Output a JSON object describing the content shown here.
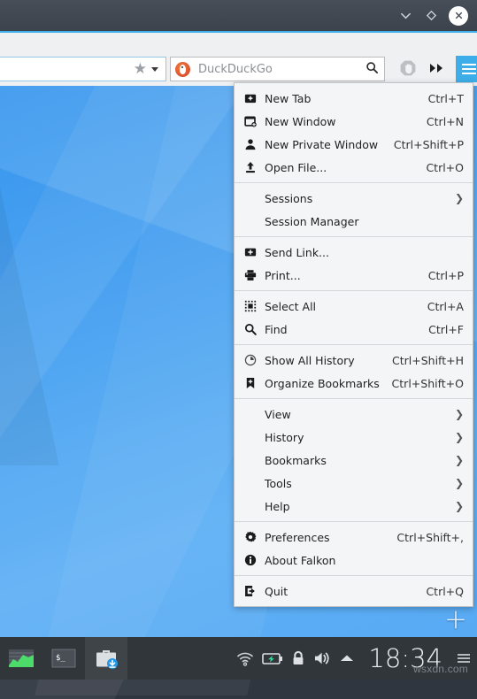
{
  "window": {
    "titlebar_buttons": [
      {
        "name": "minimize",
        "glyph": "⌄"
      },
      {
        "name": "maximize",
        "glyph": "◇"
      },
      {
        "name": "close",
        "glyph": "✕"
      }
    ]
  },
  "toolbar": {
    "url_value": "",
    "url_placeholder": "",
    "star_icon": "bookmark-star-icon",
    "search": {
      "engine_icon": "duckduckgo-icon",
      "placeholder": "DuckDuckGo",
      "value": "DuckDuckGo",
      "search_icon": "magnifier-icon"
    },
    "adblock_label": "adblock-icon",
    "forward_label": "fast-forward-icon",
    "menu_label": "hamburger-menu-icon"
  },
  "menu": {
    "groups": [
      {
        "items": [
          {
            "icon": "new-tab-icon",
            "label": "New Tab",
            "shortcut": "Ctrl+T",
            "submenu": false
          },
          {
            "icon": "new-window-icon",
            "label": "New Window",
            "shortcut": "Ctrl+N",
            "submenu": false
          },
          {
            "icon": "private-window-icon",
            "label": "New Private Window",
            "shortcut": "Ctrl+Shift+P",
            "submenu": false
          },
          {
            "icon": "open-file-icon",
            "label": "Open File...",
            "shortcut": "Ctrl+O",
            "submenu": false
          }
        ]
      },
      {
        "items": [
          {
            "icon": "",
            "label": "Sessions",
            "shortcut": "",
            "submenu": true
          },
          {
            "icon": "",
            "label": "Session Manager",
            "shortcut": "",
            "submenu": false
          }
        ]
      },
      {
        "items": [
          {
            "icon": "send-link-icon",
            "label": "Send Link...",
            "shortcut": "",
            "submenu": false
          },
          {
            "icon": "print-icon",
            "label": "Print...",
            "shortcut": "Ctrl+P",
            "submenu": false
          }
        ]
      },
      {
        "items": [
          {
            "icon": "select-all-icon",
            "label": "Select All",
            "shortcut": "Ctrl+A",
            "submenu": false
          },
          {
            "icon": "find-icon",
            "label": "Find",
            "shortcut": "Ctrl+F",
            "submenu": false
          }
        ]
      },
      {
        "items": [
          {
            "icon": "history-clock-icon",
            "label": "Show All History",
            "shortcut": "Ctrl+Shift+H",
            "submenu": false
          },
          {
            "icon": "bookmark-flag-icon",
            "label": "Organize Bookmarks",
            "shortcut": "Ctrl+Shift+O",
            "submenu": false
          }
        ]
      },
      {
        "items": [
          {
            "icon": "",
            "label": "View",
            "shortcut": "",
            "submenu": true
          },
          {
            "icon": "",
            "label": "History",
            "shortcut": "",
            "submenu": true
          },
          {
            "icon": "",
            "label": "Bookmarks",
            "shortcut": "",
            "submenu": true
          },
          {
            "icon": "",
            "label": "Tools",
            "shortcut": "",
            "submenu": true
          },
          {
            "icon": "",
            "label": "Help",
            "shortcut": "",
            "submenu": true
          }
        ]
      },
      {
        "items": [
          {
            "icon": "gear-icon",
            "label": "Preferences",
            "shortcut": "Ctrl+Shift+,",
            "submenu": false
          },
          {
            "icon": "info-icon",
            "label": "About Falkon",
            "shortcut": "",
            "submenu": false
          }
        ]
      },
      {
        "items": [
          {
            "icon": "quit-icon",
            "label": "Quit",
            "shortcut": "Ctrl+Q",
            "submenu": false
          }
        ]
      }
    ]
  },
  "desktop": {
    "add_widget_label": "+"
  },
  "taskbar": {
    "launchers": [
      {
        "name": "system-monitor-icon",
        "label": "System Monitor",
        "active": false
      },
      {
        "name": "terminal-icon",
        "label": "Terminal",
        "active": false
      },
      {
        "name": "software-store-icon",
        "label": "Software Store",
        "active": true
      }
    ],
    "tray": [
      {
        "name": "wifi-icon",
        "label": "Network"
      },
      {
        "name": "battery-icon",
        "label": "Battery"
      },
      {
        "name": "lock-icon",
        "label": "Lock"
      },
      {
        "name": "volume-icon",
        "label": "Volume"
      },
      {
        "name": "show-hidden-icon",
        "label": "Show hidden icons"
      }
    ],
    "clock": "18:34",
    "menu_label": "tray-hamburger-icon"
  },
  "watermark": "wsxdn.com"
}
